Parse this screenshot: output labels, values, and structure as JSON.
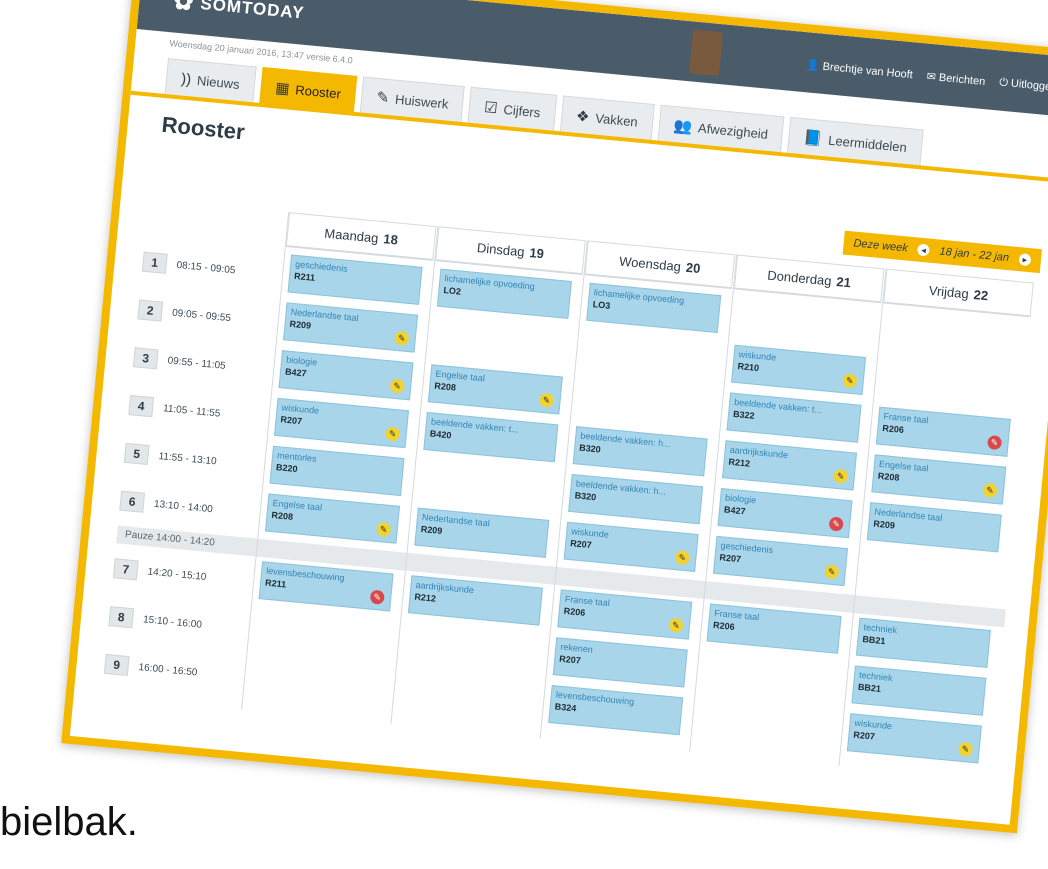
{
  "app": {
    "logo": "SOMTODAY",
    "subline": "Woensdag 20 januari 2016, 13:47 versie 6.4.0",
    "colors": {
      "accent": "#f5b800",
      "topbar": "#4a5c6a",
      "lesson": "#a8d5ea",
      "homework": "#f2d22e",
      "test": "#d9484a"
    }
  },
  "tabs": [
    {
      "label": "Nieuws",
      "icon": "rss-icon"
    },
    {
      "label": "Rooster",
      "icon": "calendar-icon"
    },
    {
      "label": "Huiswerk",
      "icon": "pencil-icon"
    },
    {
      "label": "Cijfers",
      "icon": "checklist-icon"
    },
    {
      "label": "Vakken",
      "icon": "books-icon"
    },
    {
      "label": "Afwezigheid",
      "icon": "people-icon"
    },
    {
      "label": "Leermiddelen",
      "icon": "book-icon"
    }
  ],
  "user": {
    "name": "Brechtje van Hooft",
    "messages": "Berichten",
    "logout": "Uitloggen"
  },
  "page": {
    "title": "Rooster"
  },
  "week": {
    "label": "Deze week",
    "range": "18 jan - 22 jan"
  },
  "periods": [
    {
      "num": "1",
      "time": "08:15 - 09:05"
    },
    {
      "num": "2",
      "time": "09:05 - 09:55"
    },
    {
      "num": "3",
      "time": "09:55 - 11:05"
    },
    {
      "num": "4",
      "time": "11:05 - 11:55"
    },
    {
      "num": "5",
      "time": "11:55 - 13:10"
    },
    {
      "num": "6",
      "time": "13:10 - 14:00"
    },
    {
      "num": "7",
      "time": "14:20 - 15:10"
    },
    {
      "num": "8",
      "time": "15:10 - 16:00"
    },
    {
      "num": "9",
      "time": "16:00 - 16:50"
    }
  ],
  "pause": "Pauze  14:00 - 14:20",
  "days": [
    {
      "name": "Maandag",
      "date": "18",
      "lessons": [
        {
          "subject": "geschiedenis",
          "room": "R211",
          "mark": ""
        },
        {
          "subject": "Nederlandse taal",
          "room": "R209",
          "mark": "homework"
        },
        {
          "subject": "biologie",
          "room": "B427",
          "mark": "homework"
        },
        {
          "subject": "wiskunde",
          "room": "R207",
          "mark": "homework"
        },
        {
          "subject": "mentorles",
          "room": "B220",
          "mark": ""
        },
        {
          "subject": "Engelse taal",
          "room": "R208",
          "mark": "homework"
        },
        {
          "subject": "levensbeschouwing",
          "room": "R211",
          "mark": "test"
        }
      ]
    },
    {
      "name": "Dinsdag",
      "date": "19",
      "lessons": [
        {
          "subject": "lichamelijke opvoeding",
          "room": "LO2",
          "mark": ""
        },
        {
          "subject": "Engelse taal",
          "room": "R208",
          "mark": "homework"
        },
        {
          "subject": "beeldende vakken: t...",
          "room": "B420",
          "mark": ""
        },
        {
          "subject": "Nederlandse taal",
          "room": "R209",
          "mark": ""
        },
        {
          "subject": "aardrijkskunde",
          "room": "R212",
          "mark": ""
        }
      ]
    },
    {
      "name": "Woensdag",
      "date": "20",
      "lessons": [
        {
          "subject": "lichamelijke opvoeding",
          "room": "LO3",
          "mark": ""
        },
        {
          "subject": "beeldende vakken: h...",
          "room": "B320",
          "mark": ""
        },
        {
          "subject": "beeldende vakken: h...",
          "room": "B320",
          "mark": ""
        },
        {
          "subject": "wiskunde",
          "room": "R207",
          "mark": "homework"
        },
        {
          "subject": "Franse taal",
          "room": "R206",
          "mark": "homework"
        },
        {
          "subject": "rekenen",
          "room": "R207",
          "mark": ""
        },
        {
          "subject": "levensbeschouwing",
          "room": "B324",
          "mark": ""
        }
      ]
    },
    {
      "name": "Donderdag",
      "date": "21",
      "lessons": [
        {
          "subject": "wiskunde",
          "room": "R210",
          "mark": "homework"
        },
        {
          "subject": "beeldende vakken: t...",
          "room": "B322",
          "mark": ""
        },
        {
          "subject": "aardrijkskunde",
          "room": "R212",
          "mark": "homework"
        },
        {
          "subject": "biologie",
          "room": "B427",
          "mark": "test"
        },
        {
          "subject": "geschiedenis",
          "room": "R207",
          "mark": "homework"
        },
        {
          "subject": "Franse taal",
          "room": "R206",
          "mark": ""
        }
      ]
    },
    {
      "name": "Vrijdag",
      "date": "22",
      "lessons": [
        {
          "subject": "Franse taal",
          "room": "R206",
          "mark": "test"
        },
        {
          "subject": "Engelse taal",
          "room": "R208",
          "mark": "homework"
        },
        {
          "subject": "Nederlandse taal",
          "room": "R209",
          "mark": ""
        },
        {
          "subject": "techniek",
          "room": "BB21",
          "mark": ""
        },
        {
          "subject": "techniek",
          "room": "BB21",
          "mark": ""
        },
        {
          "subject": "wiskunde",
          "room": "R207",
          "mark": "homework"
        }
      ]
    }
  ],
  "caption": "bielbak."
}
